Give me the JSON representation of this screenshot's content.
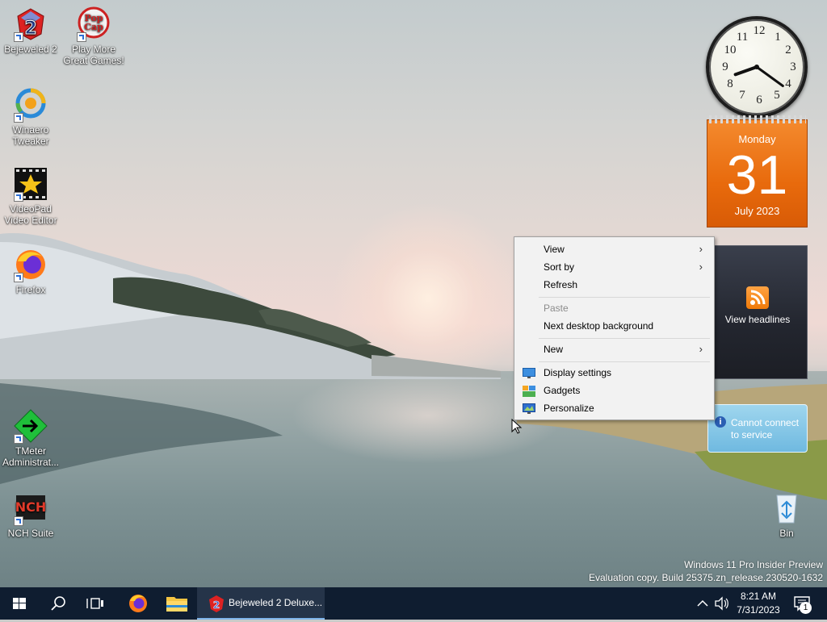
{
  "desktop_icons": [
    {
      "label": "Bejeweled 2",
      "icon": "bejeweled-icon"
    },
    {
      "label": "Play More Great Games!",
      "icon": "popcap-icon"
    },
    {
      "label": "Winaero Tweaker",
      "icon": "winaero-icon"
    },
    {
      "label": "VideoPad Video Editor",
      "icon": "videopad-icon"
    },
    {
      "label": "Firefox",
      "icon": "firefox-icon"
    },
    {
      "label": "TMeter Administrat...",
      "icon": "tmeter-icon"
    },
    {
      "label": "NCH Suite",
      "icon": "nch-icon"
    },
    {
      "label": "Bin",
      "icon": "recycle-bin-icon"
    }
  ],
  "clock": {
    "numbers": [
      "12",
      "1",
      "2",
      "3",
      "4",
      "5",
      "6",
      "7",
      "8",
      "9",
      "10",
      "11"
    ],
    "hour": 8,
    "minute": 21
  },
  "calendar": {
    "weekday": "Monday",
    "day": "31",
    "month_year": "July 2023"
  },
  "feeds": {
    "label": "View headlines"
  },
  "weather": {
    "line1": "Cannot connect",
    "line2": "to service"
  },
  "context_menu": {
    "view": "View",
    "sort_by": "Sort by",
    "refresh": "Refresh",
    "paste": "Paste",
    "next_background": "Next desktop background",
    "new": "New",
    "display_settings": "Display settings",
    "gadgets": "Gadgets",
    "personalize": "Personalize"
  },
  "watermark": {
    "line1": "Windows 11 Pro Insider Preview",
    "line2": "Evaluation copy. Build 25375.zn_release.230520-1632"
  },
  "taskbar": {
    "active_app": "Bejeweled 2 Deluxe...",
    "time": "8:21 AM",
    "date": "7/31/2023",
    "notification_count": "1"
  },
  "colors": {
    "taskbar": "#0f1d30",
    "calendar_orange": "#e86a0c",
    "menu_bg": "#f2f2f2",
    "accent": "#7eb4ea"
  }
}
